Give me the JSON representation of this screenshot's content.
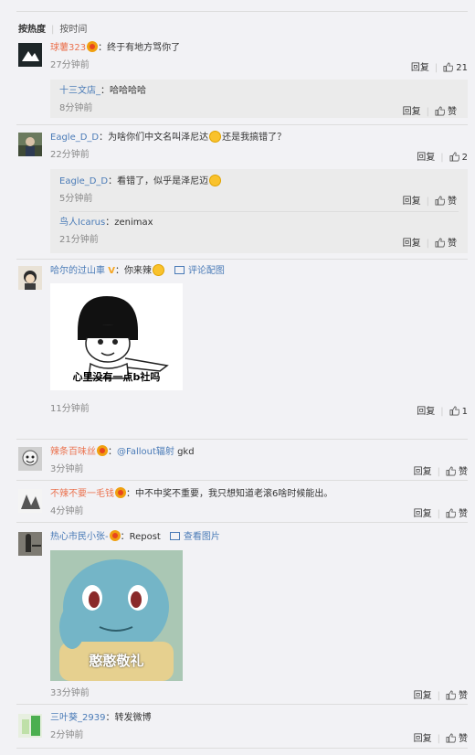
{
  "sort": {
    "hot": "按热度",
    "time": "按时间"
  },
  "actions": {
    "reply": "回复",
    "like": "赞"
  },
  "comments": [
    {
      "user": "球薯323",
      "text": "终于有地方骂你了",
      "time": "27分钟前",
      "likes": "21",
      "replies": [
        {
          "user": "十三文店_",
          "text": "哈哈哈哈",
          "time": "8分钟前",
          "likes": "赞"
        }
      ]
    },
    {
      "user": "Eagle_D_D",
      "text_before": "为啥你们中文名叫泽尼达",
      "text_after": "还是我搞错了？",
      "time": "22分钟前",
      "likes": "2",
      "replies": [
        {
          "user": "Eagle_D_D",
          "text": "看错了，似乎是泽尼迈",
          "time": "5分钟前",
          "likes": "赞"
        },
        {
          "user": "鸟人Icarus",
          "text": "zenimax",
          "time": "21分钟前",
          "likes": "赞"
        }
      ]
    },
    {
      "user": "哈尔的过山車",
      "text": "你来辣",
      "pic_link": "评论配图",
      "image_caption": "心里没有一点b社吗",
      "time": "11分钟前",
      "likes": "1"
    },
    {
      "user": "辣条百味丝",
      "mention": "@Fallout辐射",
      "text": " gkd",
      "time": "3分钟前",
      "likes": "赞"
    },
    {
      "user": "不辣不要一毛钱",
      "text": "中不中奖不重要，我只想知道老滚6啥时候能出。",
      "time": "4分钟前",
      "likes": "赞"
    },
    {
      "user": "热心市民小张-",
      "text": "Repost",
      "pic_link": "查看图片",
      "image_caption": "憨憨敬礼",
      "time": "33分钟前",
      "likes": "赞"
    },
    {
      "user": "三叶葵_2939",
      "text": "转发微博",
      "time": "2分钟前",
      "likes": "赞"
    }
  ],
  "colors": {
    "username": "#eb7350",
    "link": "#4a7bb7",
    "background": "#f2f2f5",
    "reply_bg": "#ebebeb"
  }
}
